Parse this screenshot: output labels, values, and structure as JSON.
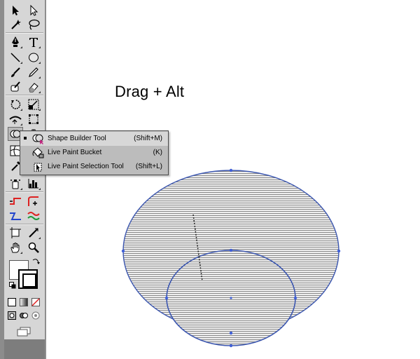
{
  "caption": "Drag + Alt",
  "flyout": {
    "items": [
      {
        "label": "Shape Builder Tool",
        "shortcut": "(Shift+M)",
        "selected": true
      },
      {
        "label": "Live Paint Bucket",
        "shortcut": "(K)",
        "selected": false
      },
      {
        "label": "Live Paint Selection Tool",
        "shortcut": "(Shift+L)",
        "selected": false
      }
    ]
  },
  "tools": [
    "selection-tool",
    "direct-selection-tool",
    "magic-wand-tool",
    "lasso-tool",
    "pen-tool",
    "type-tool",
    "line-segment-tool",
    "ellipse-tool",
    "paintbrush-tool",
    "pencil-tool",
    "blob-brush-tool",
    "eraser-tool",
    "rotate-tool",
    "scale-tool",
    "width-tool",
    "free-transform-tool",
    "shape-builder-tool",
    "perspective-grid-tool",
    "mesh-tool",
    "gradient-tool",
    "eyedropper-tool",
    "blend-tool",
    "symbol-sprayer-tool",
    "column-graph-tool",
    "slice-tool",
    "artboard-tool",
    "hand-tool",
    "zoom-tool"
  ],
  "colors": {
    "toolbar_bg": "#d6d6d6",
    "path_stroke": "#3b56b0",
    "hatch": "#8a8a8a",
    "anchor": "#3f5fd6"
  }
}
